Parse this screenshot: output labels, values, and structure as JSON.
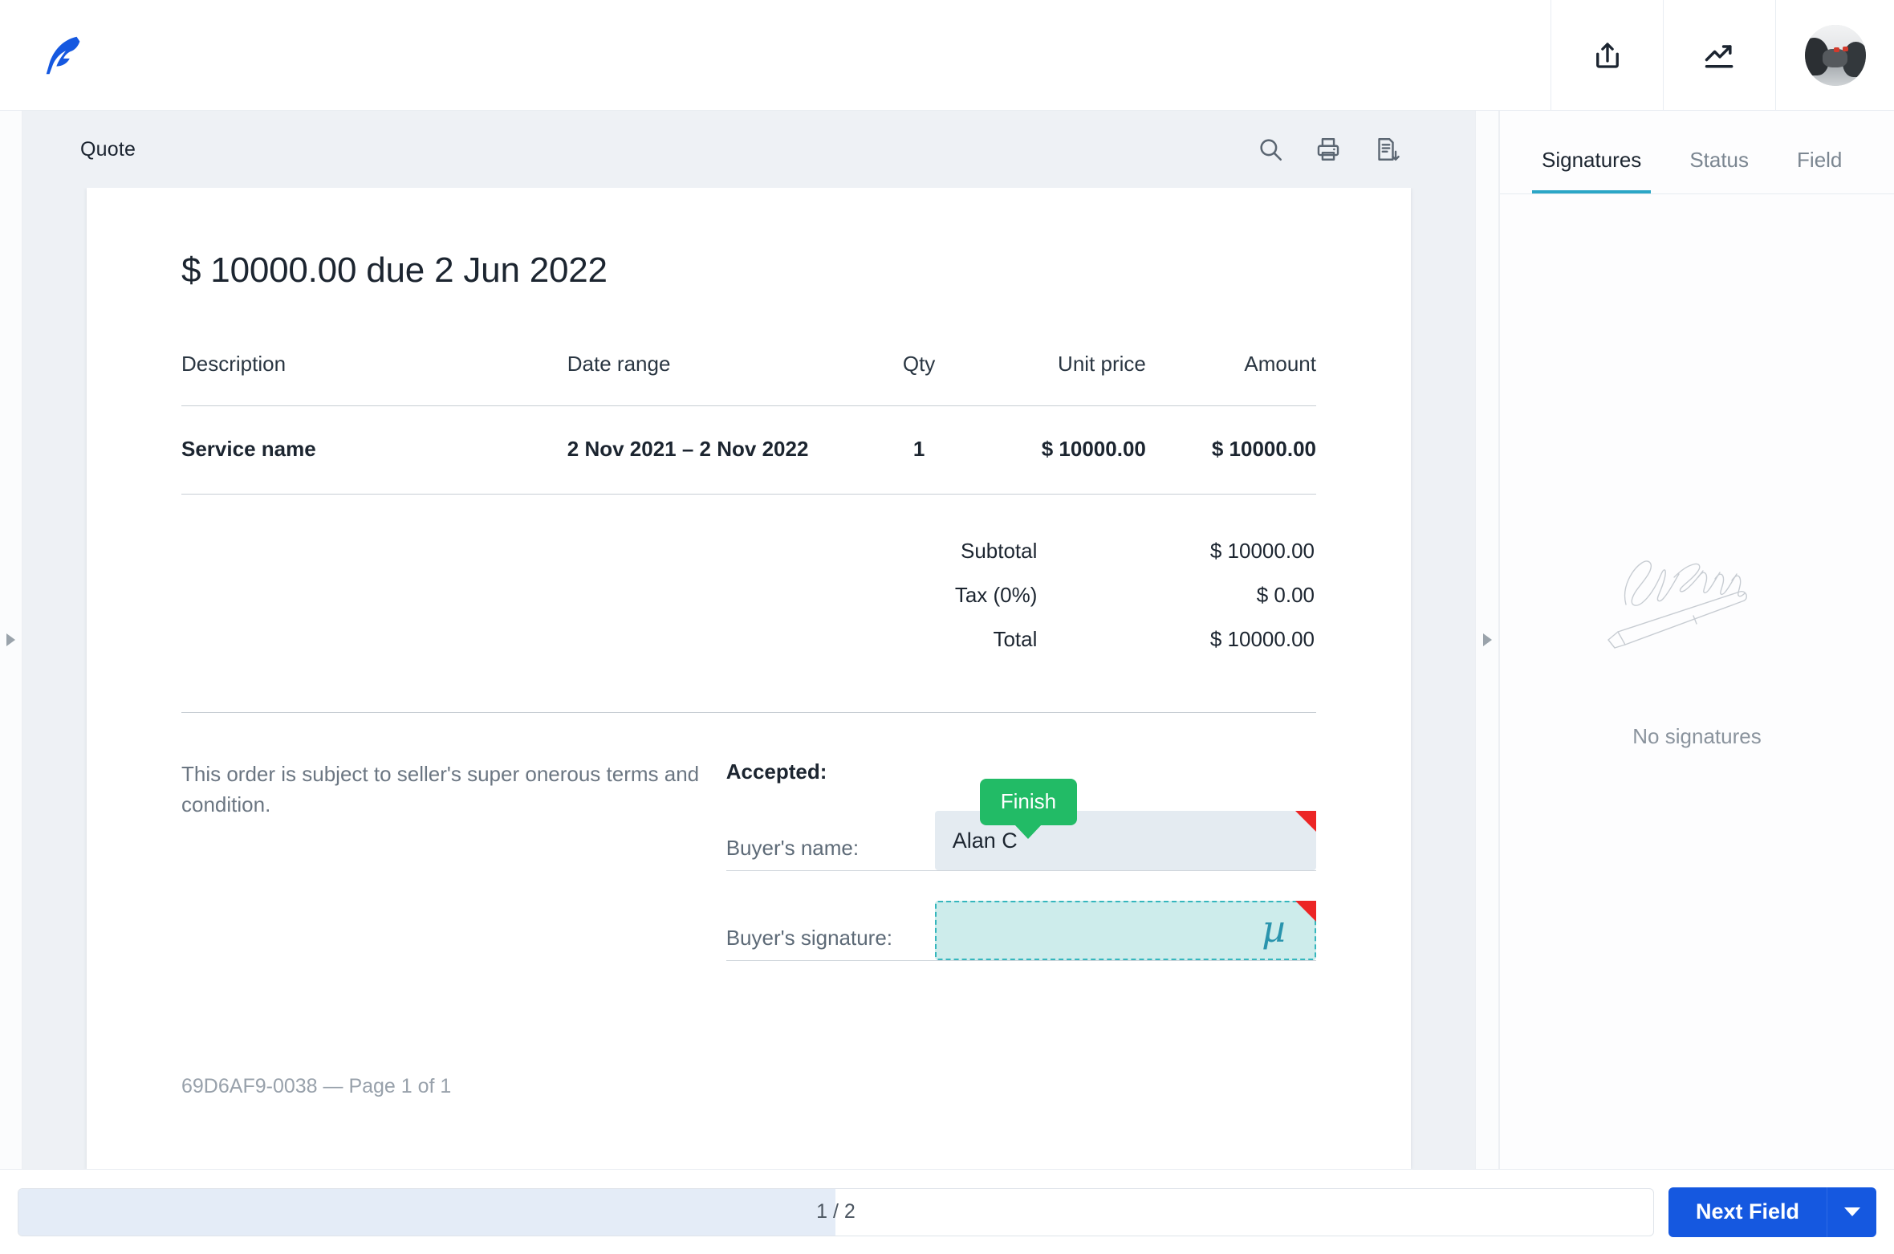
{
  "app": {
    "logo_icon": "feather-quill-icon",
    "brand_color": "#1558e0"
  },
  "topbar": {
    "share_icon": "share-icon",
    "analytics_icon": "trending-up-icon",
    "avatar_alt": "user-avatar"
  },
  "viewer": {
    "title": "Quote",
    "tools": [
      {
        "name": "search-icon",
        "label": "Search"
      },
      {
        "name": "print-icon",
        "label": "Print"
      },
      {
        "name": "download-document-icon",
        "label": "Download"
      }
    ],
    "collapse_left_icon": "chevron-right-icon",
    "collapse_right_icon": "chevron-right-icon"
  },
  "document": {
    "heading": "$ 10000.00 due 2 Jun 2022",
    "table": {
      "columns": [
        "Description",
        "Date range",
        "Qty",
        "Unit price",
        "Amount"
      ],
      "rows": [
        {
          "description": "Service name",
          "date_range": "2 Nov 2021 – 2 Nov 2022",
          "qty": "1",
          "unit_price": "$ 10000.00",
          "amount": "$ 10000.00"
        }
      ]
    },
    "totals": [
      {
        "label": "Subtotal",
        "value": "$ 10000.00"
      },
      {
        "label": "Tax (0%)",
        "value": "$ 0.00"
      },
      {
        "label": "Total",
        "value": "$ 10000.00"
      }
    ],
    "terms": "This order is subject to seller's super onerous terms and condition.",
    "accepted_title": "Accepted:",
    "fields": {
      "buyer_name_label": "Buyer's name:",
      "buyer_name_value": "Alan C",
      "buyer_signature_label": "Buyer's signature:",
      "buyer_signature_glyph": "µ"
    },
    "tooltip": {
      "label": "Finish",
      "color": "#22bb66"
    },
    "footer": "69D6AF9-0038 — Page 1 of 1"
  },
  "sidebar": {
    "tabs": [
      {
        "label": "Signatures",
        "active": true
      },
      {
        "label": "Status",
        "active": false
      },
      {
        "label": "Field",
        "active": false
      }
    ],
    "empty_state": {
      "illustration": "signature-with-pen-illustration",
      "text": "No signatures"
    },
    "active_tab_color": "#2ba6c6"
  },
  "bottombar": {
    "progress_text": "1 / 2",
    "progress_percent": 50,
    "next_button_label": "Next Field",
    "next_dropdown_icon": "caret-down-icon",
    "button_color": "#1558e0"
  }
}
